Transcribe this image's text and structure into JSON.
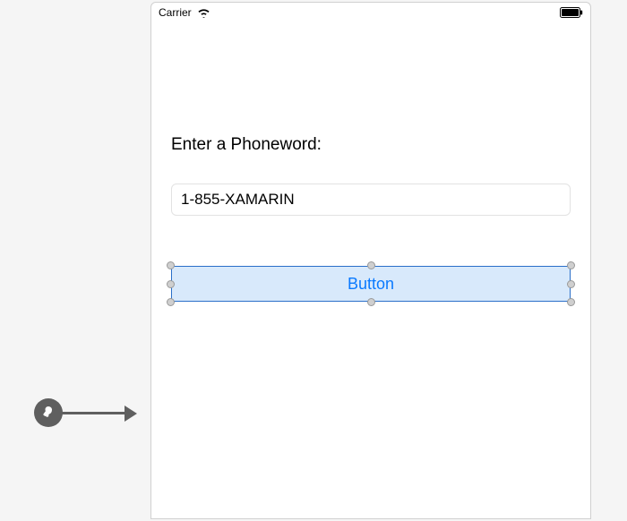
{
  "status_bar": {
    "carrier": "Carrier"
  },
  "form": {
    "prompt_label": "Enter a Phoneword:",
    "phone_value": "1-855-XAMARIN"
  },
  "button": {
    "label": "Button"
  }
}
